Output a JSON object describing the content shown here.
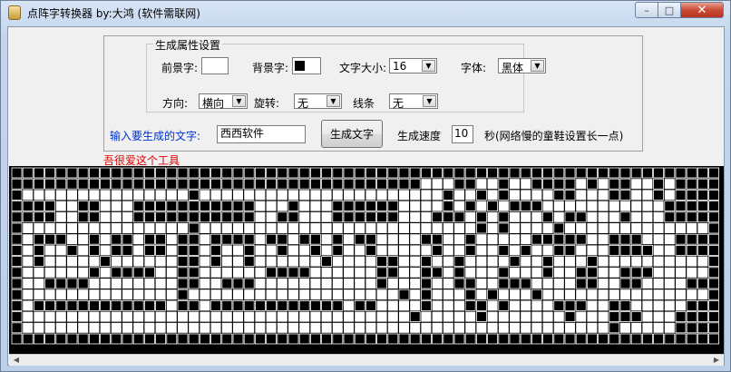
{
  "window": {
    "title": "点阵字转换器  by:大鸿 (软件需联网)",
    "min_glyph": "–",
    "max_glyph": "□",
    "close_glyph": "✕"
  },
  "settings": {
    "group_title": "生成属性设置",
    "fg_label": "前景字:",
    "bg_label": "背景字:",
    "size_label": "文字大小:",
    "size_value": "16",
    "font_label": "字体:",
    "font_value": "黑体",
    "direction_label": "方向:",
    "direction_value": "横向",
    "rotate_label": "旋转:",
    "rotate_value": "无",
    "line_label": "线条",
    "line_value": "无",
    "fg_color": "#ffffff",
    "bg_color": "#000000"
  },
  "input": {
    "prompt": "输入要生成的文字:",
    "text_value": "西西软件",
    "generate_button": "生成文字",
    "speed_label": "生成速度",
    "speed_value": "10",
    "speed_hint": "秒(网络慢的童鞋设置长一点)"
  },
  "footer_note": "吾很爱这个工具",
  "matrix": {
    "cols": 64,
    "rows": 16,
    "on_color": "#ffffff",
    "off_color": "#000000",
    "grid": [
      "0000000000000000000000000000000000000000000000000000000000000000",
      "0000000000000000000000000000000000000111001101100001010011010000",
      "0111111111111111011111111111111111111110110101111001110011010000",
      "0000110011100000000000111011100000011110101010001111111111100000",
      "0000110011100000000000110011100000011100010101110100111011100000",
      "0111111111111111011111111111111111111111110101111011111111111110",
      "0100011010010010010000100100101001111001101111100000110001110000",
      "0101101010010010010110110110101101111101101101011001110000110000",
      "0101111101111110010110111111011110011011011110110111011111111110",
      "0111111010000110011111100001111110011001011101110110011000111110",
      "0110000111111110011000111111111110111011001100011110011001111000",
      "0111111111111110111111111111111111101011101011101111111111111110",
      "0100000000000010010000000000001001111011100101111000110011111000",
      "0111111111111111111111111111111111110111110111111101110001110000",
      "0111111111111111111111111111111111111111111111111111110111110000",
      "0000000000000000000000000000000000000000000000000000000000000000"
    ]
  }
}
